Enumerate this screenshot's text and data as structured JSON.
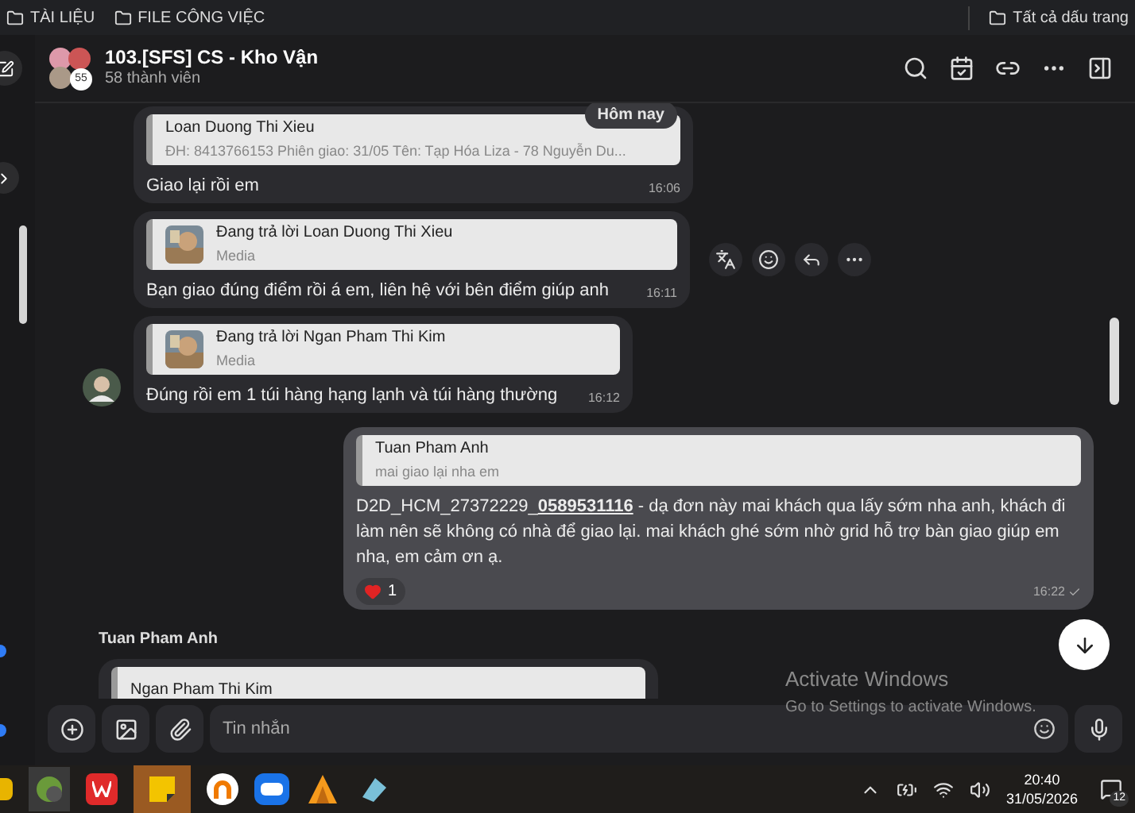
{
  "bookmarks": {
    "folders": [
      {
        "label": "TÀI LIỆU"
      },
      {
        "label": "FILE CÔNG VIỆC"
      }
    ],
    "all": "Tất cả dấu trang"
  },
  "chat": {
    "title": "103.[SFS] CS - Kho Vận",
    "members": "58 thành viên",
    "avatar_count": "55"
  },
  "date_badge": "Hôm nay",
  "messages": [
    {
      "kind": "incoming",
      "avatar": false,
      "quote": {
        "kind": "text",
        "name": "Loan Duong Thi Xieu",
        "text": "ĐH: 8413766153 Phiên giao: 31/05 Tên: Tạp Hóa Liza - 78 Nguyễn Du..."
      },
      "text": "Giao lại rồi em",
      "time": "16:06",
      "hover": false
    },
    {
      "kind": "incoming",
      "avatar": false,
      "quote": {
        "kind": "media",
        "name": "Đang trả lời Loan Duong Thi Xieu",
        "text": "Media"
      },
      "text": "Bạn giao đúng điểm rồi á em, liên hệ với bên điểm giúp anh",
      "time": "16:11",
      "hover": true
    },
    {
      "kind": "incoming",
      "avatar": true,
      "quote": {
        "kind": "media",
        "name": "Đang trả lời Ngan Pham Thi Kim",
        "text": "Media"
      },
      "text": "Đúng rồi em 1 túi hàng hạng lạnh và túi hàng thường",
      "time": "16:12",
      "hover": false
    },
    {
      "kind": "outgoing",
      "quote": {
        "kind": "text",
        "name": "Tuan Pham Anh",
        "text": "mai giao lại nha em"
      },
      "text": "D2D_HCM_27372229_**0589531116** - dạ đơn này mai khách qua lấy sớm nha anh, khách đi làm nên sẽ không có nhà để giao lại. mai khách ghé sớm nhờ grid hỗ trợ bàn giao giúp em nha, em cảm ơn ạ.",
      "time": "16:22",
      "reaction": "1",
      "hover": false
    }
  ],
  "next_sender": "Tuan Pham Anh",
  "next_quote": "Ngan Pham Thi Kim",
  "composer": {
    "placeholder": "Tin nhắn"
  },
  "activation": {
    "title": "Activate Windows",
    "text": "Go to Settings to activate Windows."
  },
  "tray": {
    "time": "20:40",
    "date": "31/05/2026",
    "notifications": "12"
  }
}
